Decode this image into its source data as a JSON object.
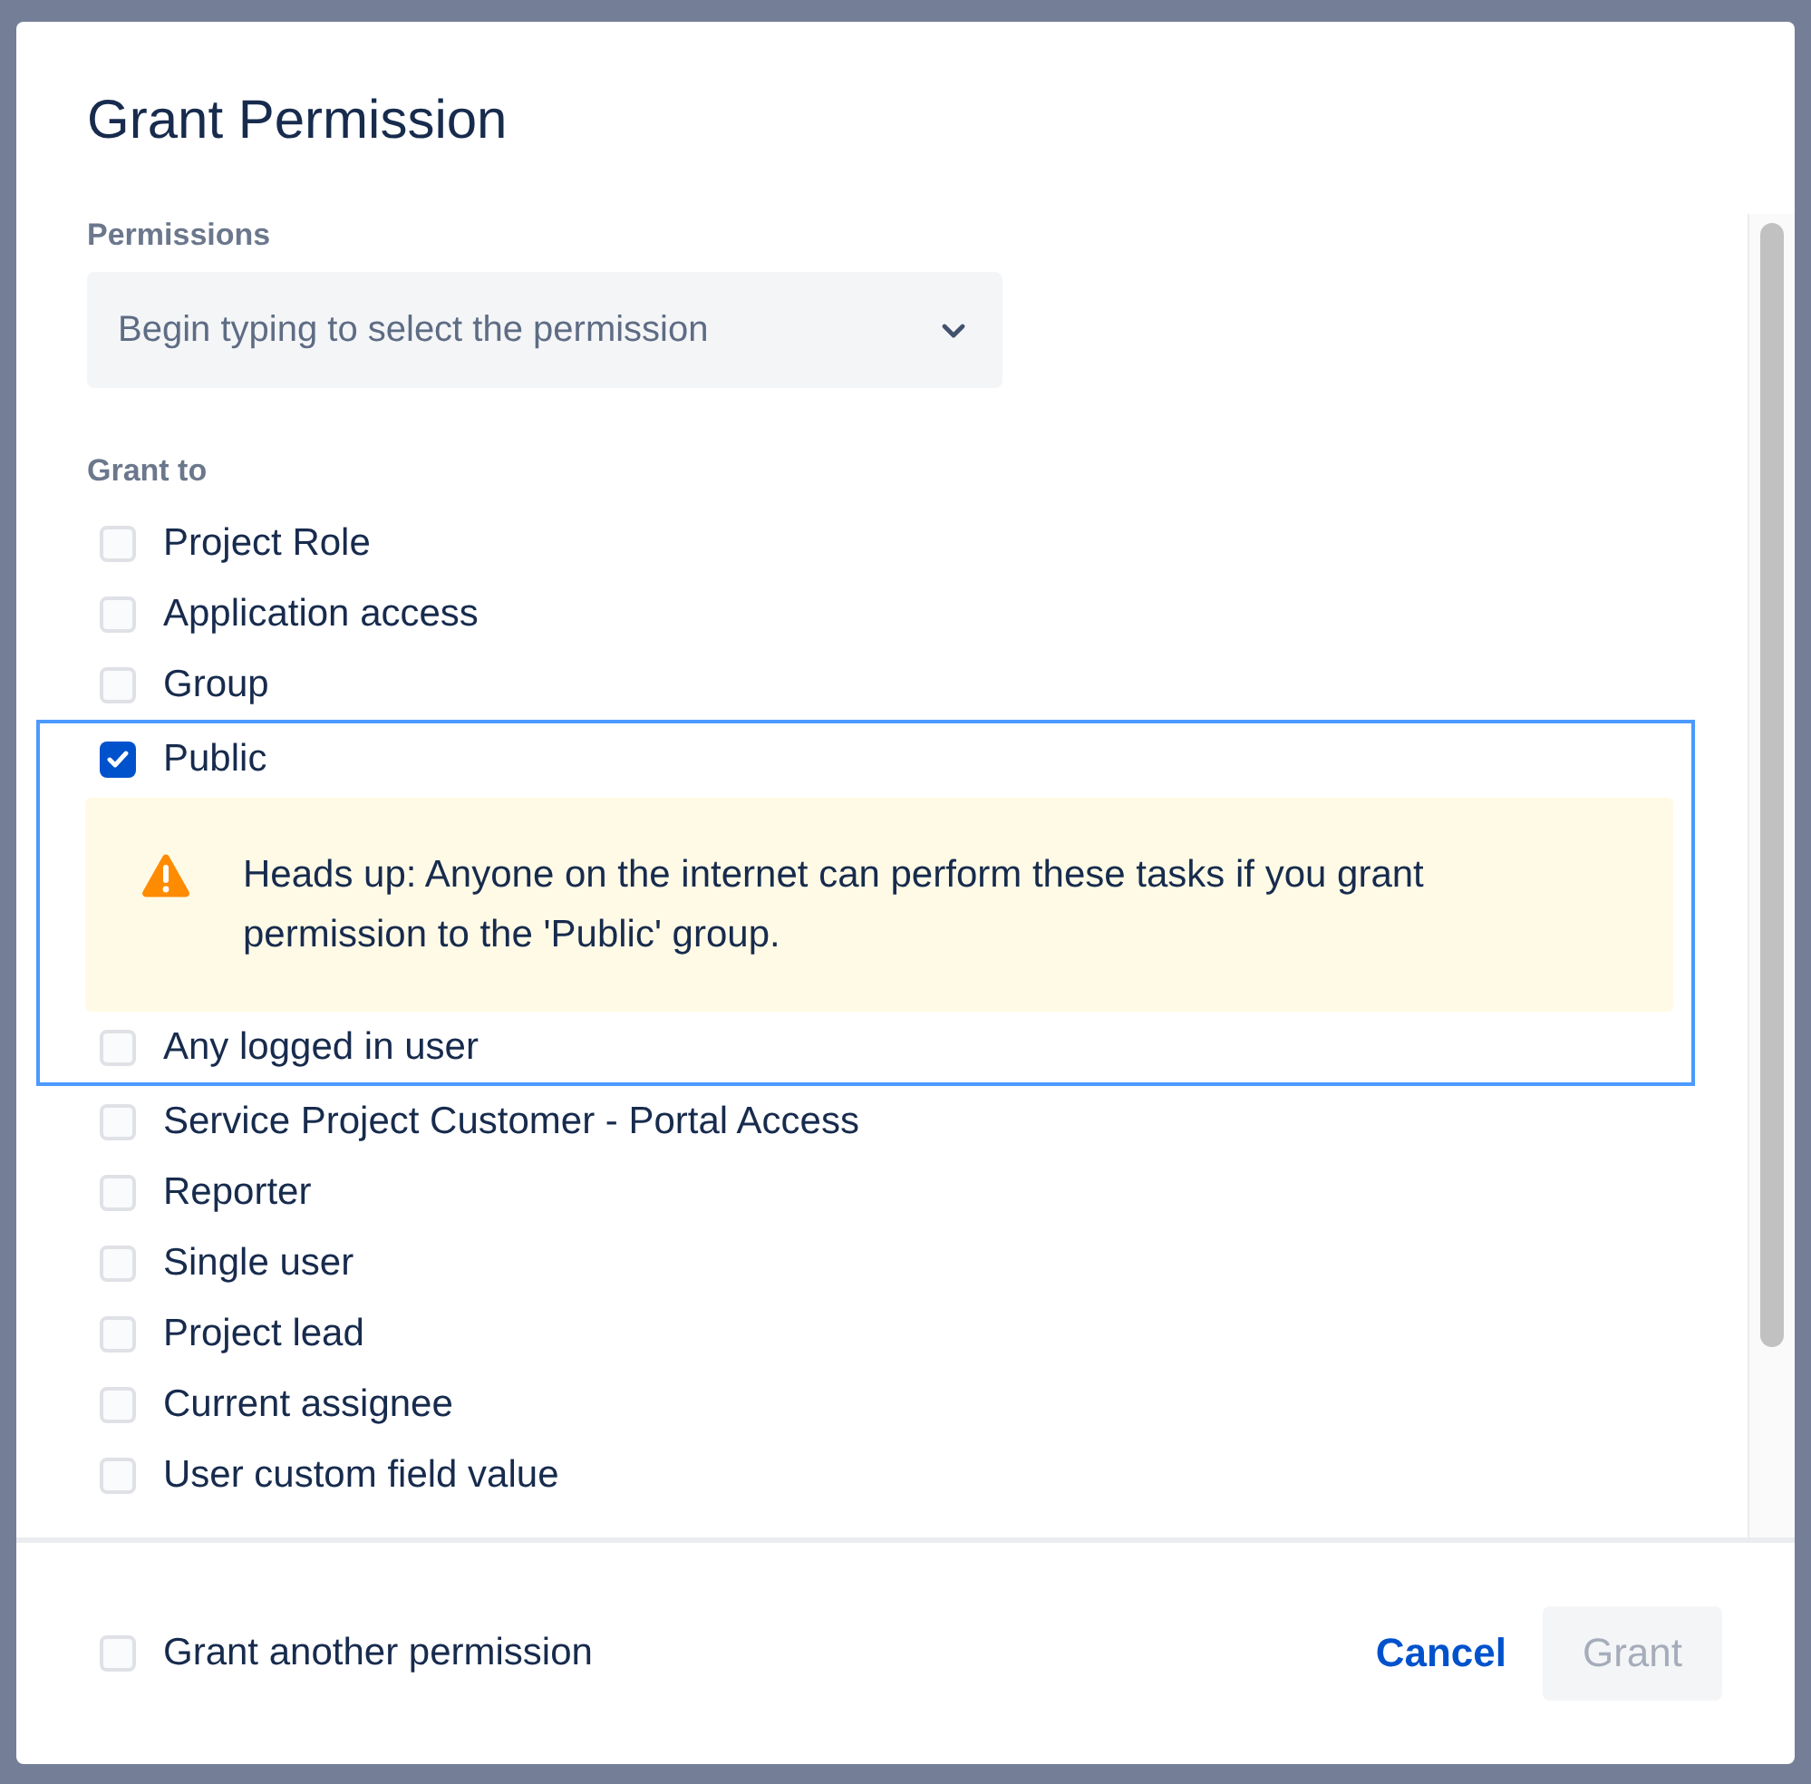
{
  "dialog": {
    "title": "Grant Permission"
  },
  "permissions": {
    "label": "Permissions",
    "placeholder": "Begin typing to select the permission"
  },
  "grant_to": {
    "label": "Grant to",
    "options": [
      {
        "label": "Project Role",
        "checked": false,
        "highlighted": false
      },
      {
        "label": "Application access",
        "checked": false,
        "highlighted": false
      },
      {
        "label": "Group",
        "checked": false,
        "highlighted": false
      },
      {
        "label": "Public",
        "checked": true,
        "highlighted": true,
        "warning": "Heads up: Anyone on the internet can perform these tasks if you grant permission to the 'Public' group."
      },
      {
        "label": "Any logged in user",
        "checked": false,
        "highlighted": true
      },
      {
        "label": "Service Project Customer - Portal Access",
        "checked": false,
        "highlighted": false
      },
      {
        "label": "Reporter",
        "checked": false,
        "highlighted": false
      },
      {
        "label": "Single user",
        "checked": false,
        "highlighted": false
      },
      {
        "label": "Project lead",
        "checked": false,
        "highlighted": false
      },
      {
        "label": "Current assignee",
        "checked": false,
        "highlighted": false
      },
      {
        "label": "User custom field value",
        "checked": false,
        "highlighted": false
      }
    ]
  },
  "footer": {
    "grant_another": {
      "label": "Grant another permission",
      "checked": false
    },
    "cancel": "Cancel",
    "grant": {
      "label": "Grant",
      "disabled": true
    }
  }
}
